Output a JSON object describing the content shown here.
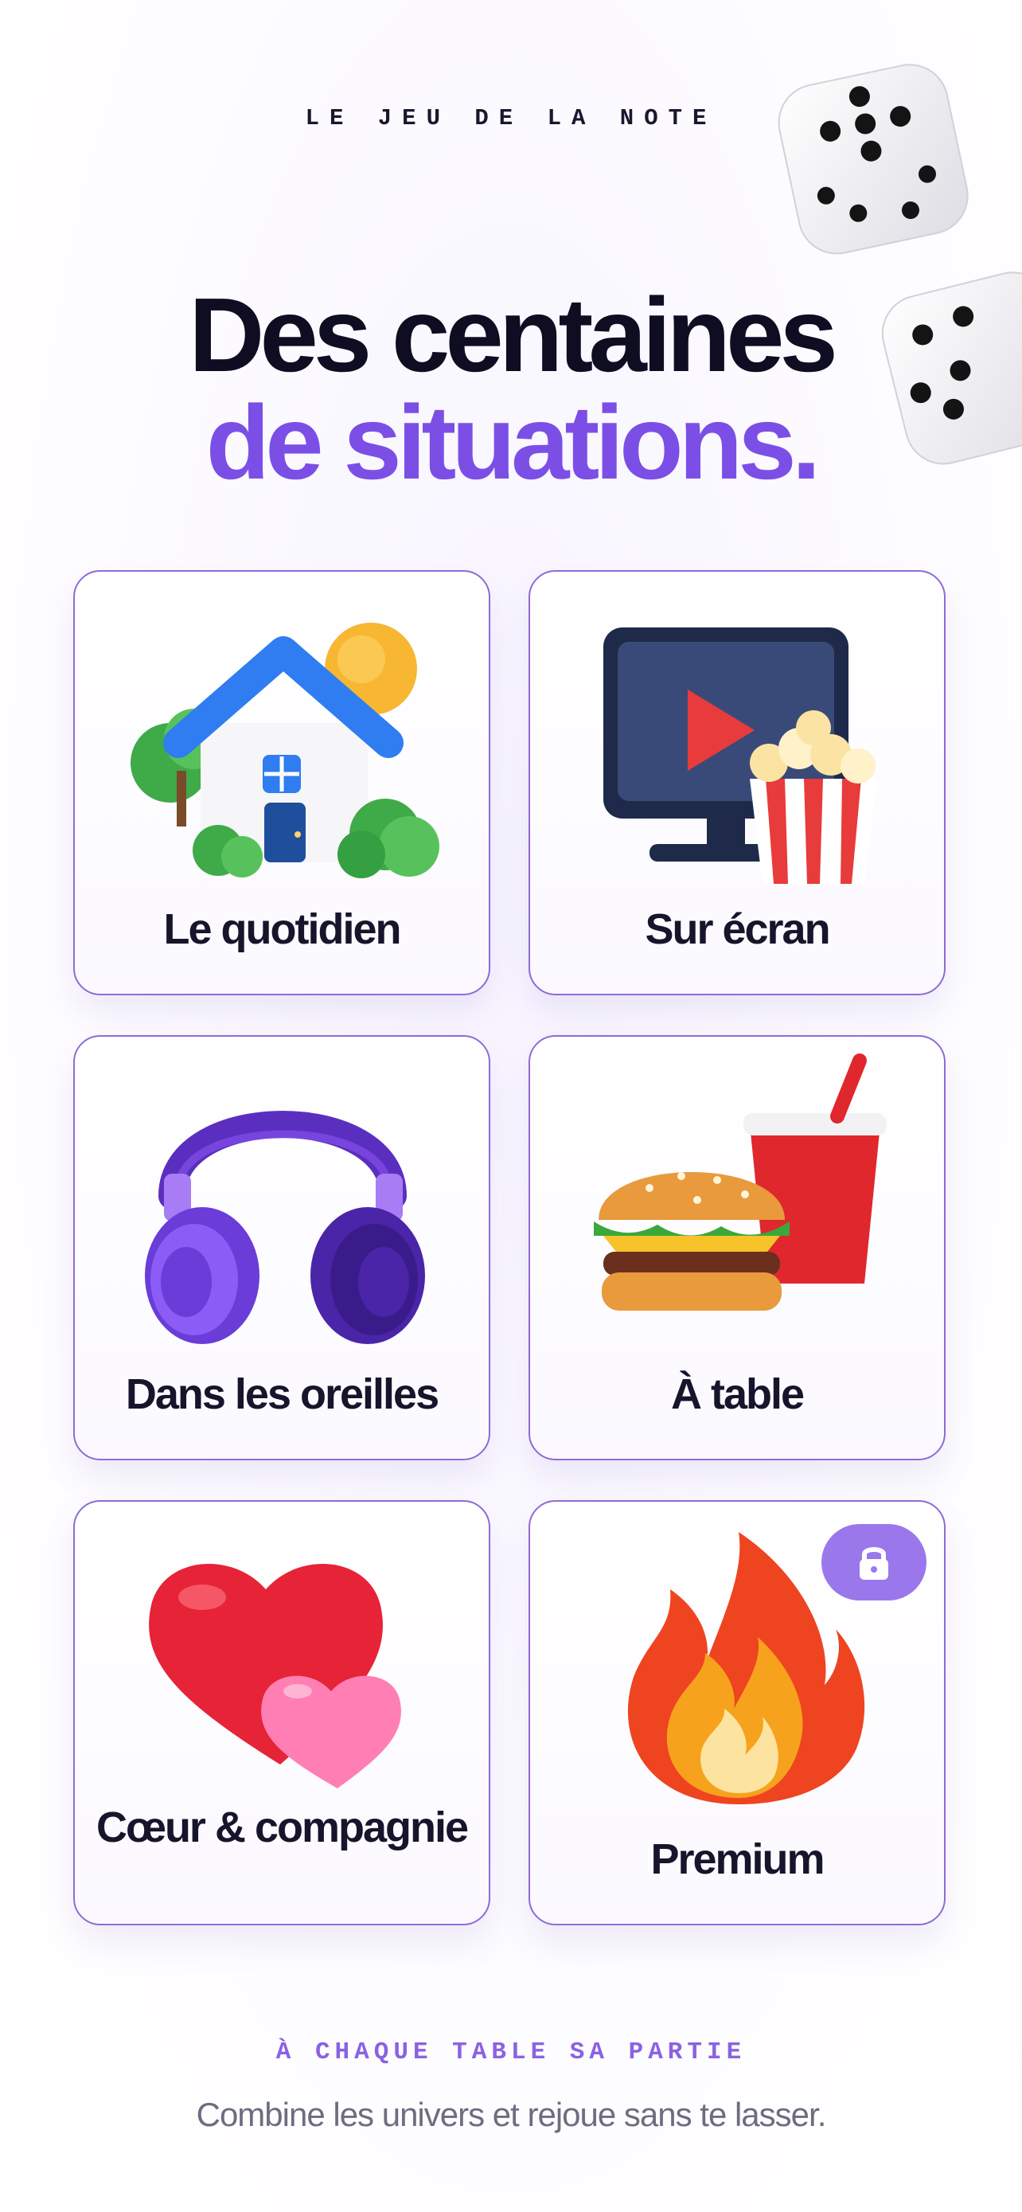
{
  "header": {
    "eyebrow": "LE JEU DE LA NOTE",
    "title_line1": "Des centaines",
    "title_line2": "de situations."
  },
  "categories": [
    {
      "label": "Le quotidien",
      "icon": "house-icon",
      "locked": false
    },
    {
      "label": "Sur écran",
      "icon": "tv-popcorn-icon",
      "locked": false
    },
    {
      "label": "Dans les oreilles",
      "icon": "headphones-icon",
      "locked": false
    },
    {
      "label": "À table",
      "icon": "burger-drink-icon",
      "locked": false
    },
    {
      "label": "Cœur & compagnie",
      "icon": "hearts-icon",
      "locked": false
    },
    {
      "label": "Premium",
      "icon": "flame-icon",
      "locked": true
    }
  ],
  "footer": {
    "tagline": "À CHAQUE TABLE SA PARTIE",
    "subtitle": "Combine les univers et rejoue sans te lasser."
  },
  "colors": {
    "accent": "#7b4fe6",
    "title": "#0f0d22",
    "card_border": "#8e6bd6",
    "lock_badge": "#9a78ec"
  }
}
